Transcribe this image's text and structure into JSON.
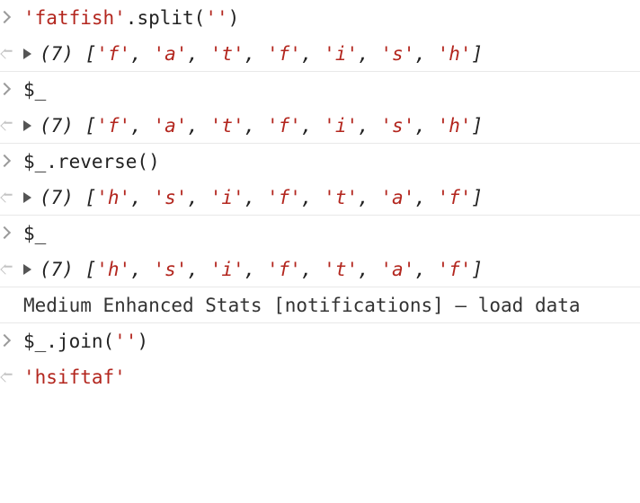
{
  "console": {
    "entries": [
      {
        "kind": "input",
        "text_parts": [
          "'fatfish'",
          ".split(",
          "''",
          ")"
        ]
      },
      {
        "kind": "array",
        "count": "(7)",
        "items": [
          "'f'",
          "'a'",
          "'t'",
          "'f'",
          "'i'",
          "'s'",
          "'h'"
        ]
      },
      {
        "kind": "input",
        "text": "$_"
      },
      {
        "kind": "array",
        "count": "(7)",
        "items": [
          "'f'",
          "'a'",
          "'t'",
          "'f'",
          "'i'",
          "'s'",
          "'h'"
        ]
      },
      {
        "kind": "input",
        "text": "$_.reverse()"
      },
      {
        "kind": "array",
        "count": "(7)",
        "items": [
          "'h'",
          "'s'",
          "'i'",
          "'f'",
          "'t'",
          "'a'",
          "'f'"
        ]
      },
      {
        "kind": "input",
        "text": "$_"
      },
      {
        "kind": "array",
        "count": "(7)",
        "items": [
          "'h'",
          "'s'",
          "'i'",
          "'f'",
          "'t'",
          "'a'",
          "'f'"
        ]
      },
      {
        "kind": "log",
        "text": "Medium Enhanced Stats [notifications] – load data"
      },
      {
        "kind": "input",
        "text_parts": [
          "$_.join(",
          "''",
          ")"
        ]
      },
      {
        "kind": "result",
        "text": "'hsiftaf'"
      }
    ]
  },
  "icons": {
    "prompt": "chevron-right-icon",
    "result": "return-arrow-icon",
    "expand": "expand-triangle-icon"
  },
  "colors": {
    "string": "#b3261e",
    "text": "#222222",
    "separator": "#e8e8e8"
  }
}
